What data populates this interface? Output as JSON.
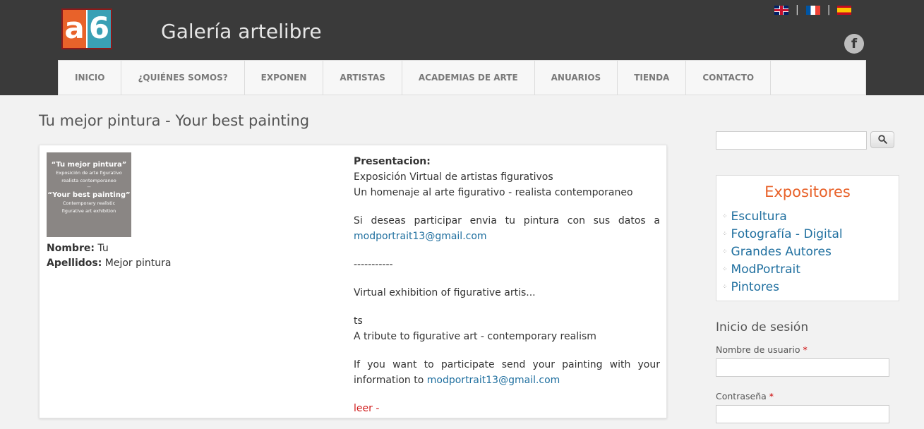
{
  "header": {
    "logo": {
      "left": "a",
      "right": "6"
    },
    "site_title": "Galería artelibre",
    "languages": [
      "en",
      "fr",
      "es"
    ],
    "facebook_icon": "facebook-icon"
  },
  "nav": {
    "items": [
      "INICIO",
      "¿QUIÉNES SOMOS?",
      "EXPONEN",
      "ARTISTAS",
      "ACADEMIAS DE ARTE",
      "ANUARIOS",
      "TIENDA",
      "CONTACTO"
    ]
  },
  "page_title": "Tu mejor pintura - Your best painting",
  "card": {
    "thumbnail": {
      "title1": "“Tu mejor pintura”",
      "sub1a": "Exposición de arte figurativo",
      "sub1b": "realista contemporaneo",
      "dash": "--",
      "title2": "“Your best painting”",
      "sub2a": "Contemporary realistic",
      "sub2b": "figurative art exhibition"
    },
    "nombre_label": "Nombre:",
    "nombre_value": "Tu",
    "apellidos_label": "Apellidos:",
    "apellidos_value": "Mejor pintura",
    "desc": {
      "presentacion_label": "Presentacion:",
      "line1": "Exposición Virtual de artistas figurativos",
      "line2": "Un homenaje al arte figurativo - realista contemporaneo",
      "participate_es": "Si deseas participar envia tu pintura con sus datos a",
      "email1": "modportrait13@gmail.com",
      "divider": "-----------",
      "virtual_en": "Virtual exhibition of figurative artis...",
      "ts": "ts",
      "tribute_en": "A tribute to figurative art - contemporary realism",
      "participate_en": "If you want to participate send your painting with your",
      "info_to": "information to",
      "email2": "modportrait13@gmail.com",
      "leer": "leer -"
    }
  },
  "sidebar": {
    "search_placeholder": "",
    "search_icon": "search-icon",
    "expositores_title": "Expositores",
    "expositores_items": [
      "Escultura",
      "Fotografía - Digital",
      "Grandes Autores",
      "ModPortrait",
      "Pintores"
    ],
    "login_title": "Inicio de sesión",
    "username_label": "Nombre de usuario",
    "password_label": "Contraseña",
    "required_mark": "*"
  },
  "colors": {
    "header_bg": "#3a3a3a",
    "accent_orange": "#e8622a",
    "link_blue": "#1f6f9f",
    "leer_red": "#d01c1c"
  }
}
